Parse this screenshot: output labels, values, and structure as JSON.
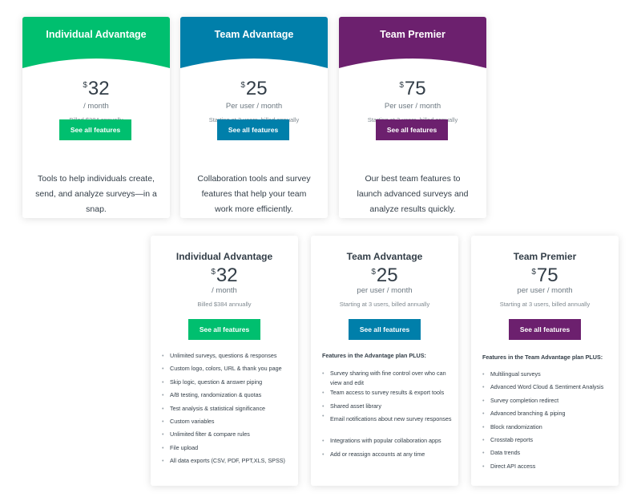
{
  "colors": {
    "green": "#00bf6f",
    "blue": "#007faa",
    "purple": "#6c206e"
  },
  "top_cards": [
    {
      "title": "Individual Advantage",
      "currency": "$",
      "price": "32",
      "per": "/ month",
      "billed": "Billed $384 annually",
      "button": "See all features",
      "description": "Tools to help individuals create, send, and analyze surveys—in a snap."
    },
    {
      "title": "Team Advantage",
      "currency": "$",
      "price": "25",
      "per": "Per user / month",
      "billed": "Starting at 3 users, billed annually",
      "button": "See all features",
      "description": "Collaboration tools and survey features that help your team work more efficiently."
    },
    {
      "title": "Team Premier",
      "currency": "$",
      "price": "75",
      "per": "Per user / month",
      "billed": "Starting at 3 users, billed annually",
      "button": "See all features",
      "description": "Our best team features to launch advanced surveys and analyze results quickly."
    }
  ],
  "bottom_cards": [
    {
      "title": "Individual Advantage",
      "currency": "$",
      "price": "32",
      "per": "/ month",
      "billed": "Billed $384 annually",
      "button": "See all features",
      "features": [
        "Unlimited surveys, questions & responses",
        "Custom logo, colors, URL & thank you page",
        "Skip logic, question & answer piping",
        "A/B testing, randomization & quotas",
        "Test analysis & statistical significance",
        "Custom variables",
        "Unlimited filter & compare rules",
        "File upload",
        "All data exports (CSV, PDF, PPT,XLS, SPSS)"
      ]
    },
    {
      "title": "Team Advantage",
      "currency": "$",
      "price": "25",
      "per": "per user / month",
      "billed": "Starting at 3 users, billed annually",
      "button": "See all features",
      "plus_heading": "Features in the Advantage plan PLUS:",
      "features": [
        "Survey sharing with fine control over who can view and edit",
        "Team access to survey results & export tools",
        "Shared asset library",
        "Email notifications about new survey responses",
        "Integrations with popular collaboration apps",
        "Add or reassign accounts at any time"
      ]
    },
    {
      "title": "Team Premier",
      "currency": "$",
      "price": "75",
      "per": "per user / month",
      "billed": "Starting at 3 users, billed annually",
      "button": "See all features",
      "plus_heading": "Features in the Team Advantage plan PLUS:",
      "features": [
        "Multilingual surveys",
        "Advanced Word Cloud & Sentiment Analysis",
        "Survey completion redirect",
        "Advanced branching & piping",
        "Block randomization",
        "Crosstab reports",
        "Data trends",
        "Direct API access"
      ]
    }
  ]
}
